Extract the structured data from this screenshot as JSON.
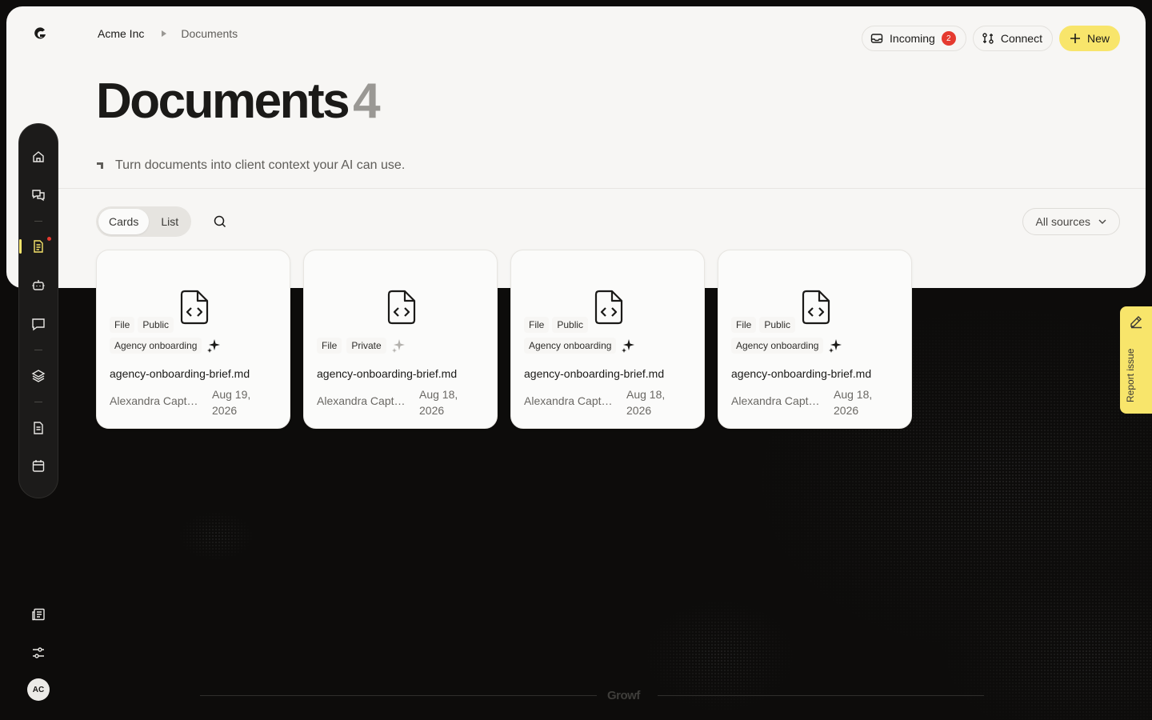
{
  "app": {
    "brand": "Growf",
    "accent_color": "#f8e56b",
    "alert_color": "#e53a2f"
  },
  "breadcrumb": {
    "org": "Acme Inc",
    "page": "Documents"
  },
  "top_actions": {
    "incoming_label": "Incoming",
    "incoming_count": "2",
    "connect_label": "Connect",
    "new_label": "New"
  },
  "header": {
    "title": "Documents",
    "count": "4",
    "subtitle": "Turn documents into client context your AI can use."
  },
  "view_toggle": {
    "options": [
      "Cards",
      "List"
    ],
    "selected": "Cards"
  },
  "filter": {
    "label": "All sources"
  },
  "documents": [
    {
      "type_tag": "File",
      "visibility": "Public",
      "category": "Agency onboarding",
      "name": "agency-onboarding-brief.md",
      "author": "Alexandra Captain",
      "date": "Aug 19, 2026"
    },
    {
      "type_tag": "File",
      "visibility": "Private",
      "category": "",
      "name": "agency-onboarding-brief.md",
      "author": "Alexandra Captain",
      "date": "Aug 18, 2026"
    },
    {
      "type_tag": "File",
      "visibility": "Public",
      "category": "Agency onboarding",
      "name": "agency-onboarding-brief.md",
      "author": "Alexandra Captain",
      "date": "Aug 18, 2026"
    },
    {
      "type_tag": "File",
      "visibility": "Public",
      "category": "Agency onboarding",
      "name": "agency-onboarding-brief.md",
      "author": "Alexandra Captain",
      "date": "Aug 18, 2026"
    }
  ],
  "sidebar": {
    "items": [
      {
        "icon": "home-icon",
        "active": false
      },
      {
        "icon": "chat-bubbles-icon",
        "active": false
      },
      {
        "icon": "document-icon",
        "active": true
      },
      {
        "icon": "bot-icon",
        "active": false
      },
      {
        "icon": "message-icon",
        "active": false
      },
      {
        "icon": "layers-icon",
        "active": false
      },
      {
        "icon": "file-text-icon",
        "active": false
      },
      {
        "icon": "calendar-icon",
        "active": false
      }
    ]
  },
  "user": {
    "initials": "AC"
  },
  "report_issue": {
    "label": "Report issue"
  }
}
